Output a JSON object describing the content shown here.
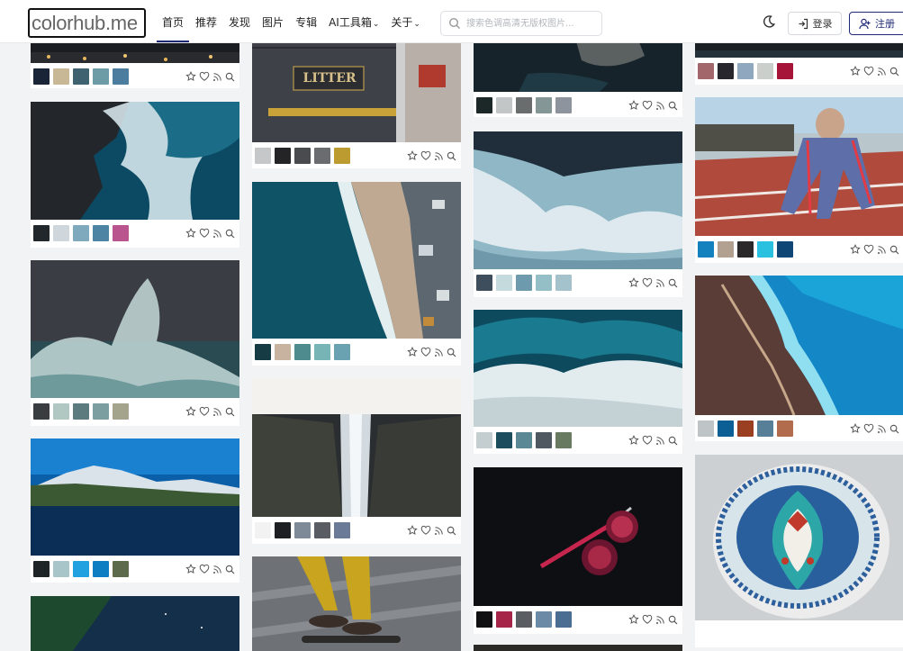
{
  "header": {
    "logo_text": "colorhub.me",
    "nav": [
      {
        "label": "首页",
        "active": true
      },
      {
        "label": "推荐"
      },
      {
        "label": "发现"
      },
      {
        "label": "图片"
      },
      {
        "label": "专辑"
      },
      {
        "label": "AI工具箱",
        "dropdown": true
      },
      {
        "label": "关于",
        "dropdown": true
      }
    ],
    "search_placeholder": "搜索色调高清无版权图片...",
    "login_label": "登录",
    "register_label": "注册",
    "icons": {
      "search": "search-icon",
      "theme": "moon-icon",
      "login": "login-icon",
      "register": "user-plus-icon"
    }
  },
  "accent_color": "#1e2a78",
  "card_actions": [
    "star-icon",
    "heart-icon",
    "rss-icon",
    "zoom-icon"
  ],
  "cards": [
    {
      "id": "c1-1",
      "subject": "cave with lights",
      "palette": [
        "#1a2437",
        "#c9b896",
        "#3f6270",
        "#6d9ba6",
        "#4c7d9e"
      ]
    },
    {
      "id": "c1-2",
      "subject": "waves on dark rocks",
      "palette": [
        "#22272b",
        "#cfd7dc",
        "#7fa9bc",
        "#4d84a3",
        "#b9548e"
      ]
    },
    {
      "id": "c1-3",
      "subject": "wave splash on dark sea",
      "palette": [
        "#3a3d40",
        "#b1c7c2",
        "#5b7b7e",
        "#7c9ea1",
        "#a4a38c"
      ]
    },
    {
      "id": "c1-4",
      "subject": "mountain lake at night",
      "palette": [
        "#1e2326",
        "#a8c6c9",
        "#22a1e0",
        "#0e7ec3",
        "#5e6a4c"
      ]
    },
    {
      "id": "c1-5",
      "subject": "plants under night sky",
      "palette": []
    },
    {
      "id": "c2-1",
      "subject": "litter bin",
      "sign_text": "LITTER",
      "palette": [
        "#c5c7c9",
        "#242426",
        "#4a4b4e",
        "#6a6c70",
        "#bc9b31"
      ]
    },
    {
      "id": "c2-2",
      "subject": "aerial coastline",
      "palette": [
        "#173b45",
        "#c8b3a0",
        "#4e8b8f",
        "#77b4b6",
        "#6aa2b2"
      ]
    },
    {
      "id": "c2-3",
      "subject": "waterfall over cliff",
      "palette": [
        "#f2f2f2",
        "#1d1f22",
        "#7e8a98",
        "#5a5c63",
        "#6b7a96"
      ]
    },
    {
      "id": "c2-4",
      "subject": "skateboarder yellow pants",
      "palette": []
    },
    {
      "id": "c3-1",
      "subject": "hands on dark background",
      "palette": [
        "#1c2728",
        "#c3c6c6",
        "#6a6d6e",
        "#859696",
        "#8e949e"
      ]
    },
    {
      "id": "c3-2",
      "subject": "aerial sea foam",
      "palette": [
        "#3f4e5c",
        "#c5dadd",
        "#6e9aae",
        "#94bfc6",
        "#a3c2cc"
      ]
    },
    {
      "id": "c3-3",
      "subject": "breaking ocean wave",
      "palette": [
        "#c4ced0",
        "#1b4d5e",
        "#5b8895",
        "#4f5860",
        "#687a5f"
      ]
    },
    {
      "id": "c3-4",
      "subject": "knife and pomegranate",
      "palette": [
        "#101012",
        "#a52448",
        "#5a5d62",
        "#6b8aa6",
        "#4b6d91"
      ]
    },
    {
      "id": "c4-1",
      "subject": "dark landscape",
      "palette": [
        "#1e2a32",
        "#23a3d6",
        "#c2c9c9",
        "#0e78c6",
        "#6e7560"
      ]
    },
    {
      "id": "c4-2",
      "subject": "runner on track",
      "palette": [
        "#a1676a",
        "#27272d",
        "#8fa7bf",
        "#cbcfcc",
        "#a61538"
      ]
    },
    {
      "id": "c4-3",
      "subject": "aerial cliff and sea",
      "palette": [
        "#1281bd",
        "#b2a191",
        "#2a2829",
        "#2ac1e0",
        "#0e4676"
      ]
    },
    {
      "id": "c4-4",
      "subject": "decorated ceramic plate",
      "palette": [
        "#bfc4c6",
        "#0b5f95",
        "#9b3f23",
        "#577f97",
        "#b06c4c"
      ]
    }
  ]
}
